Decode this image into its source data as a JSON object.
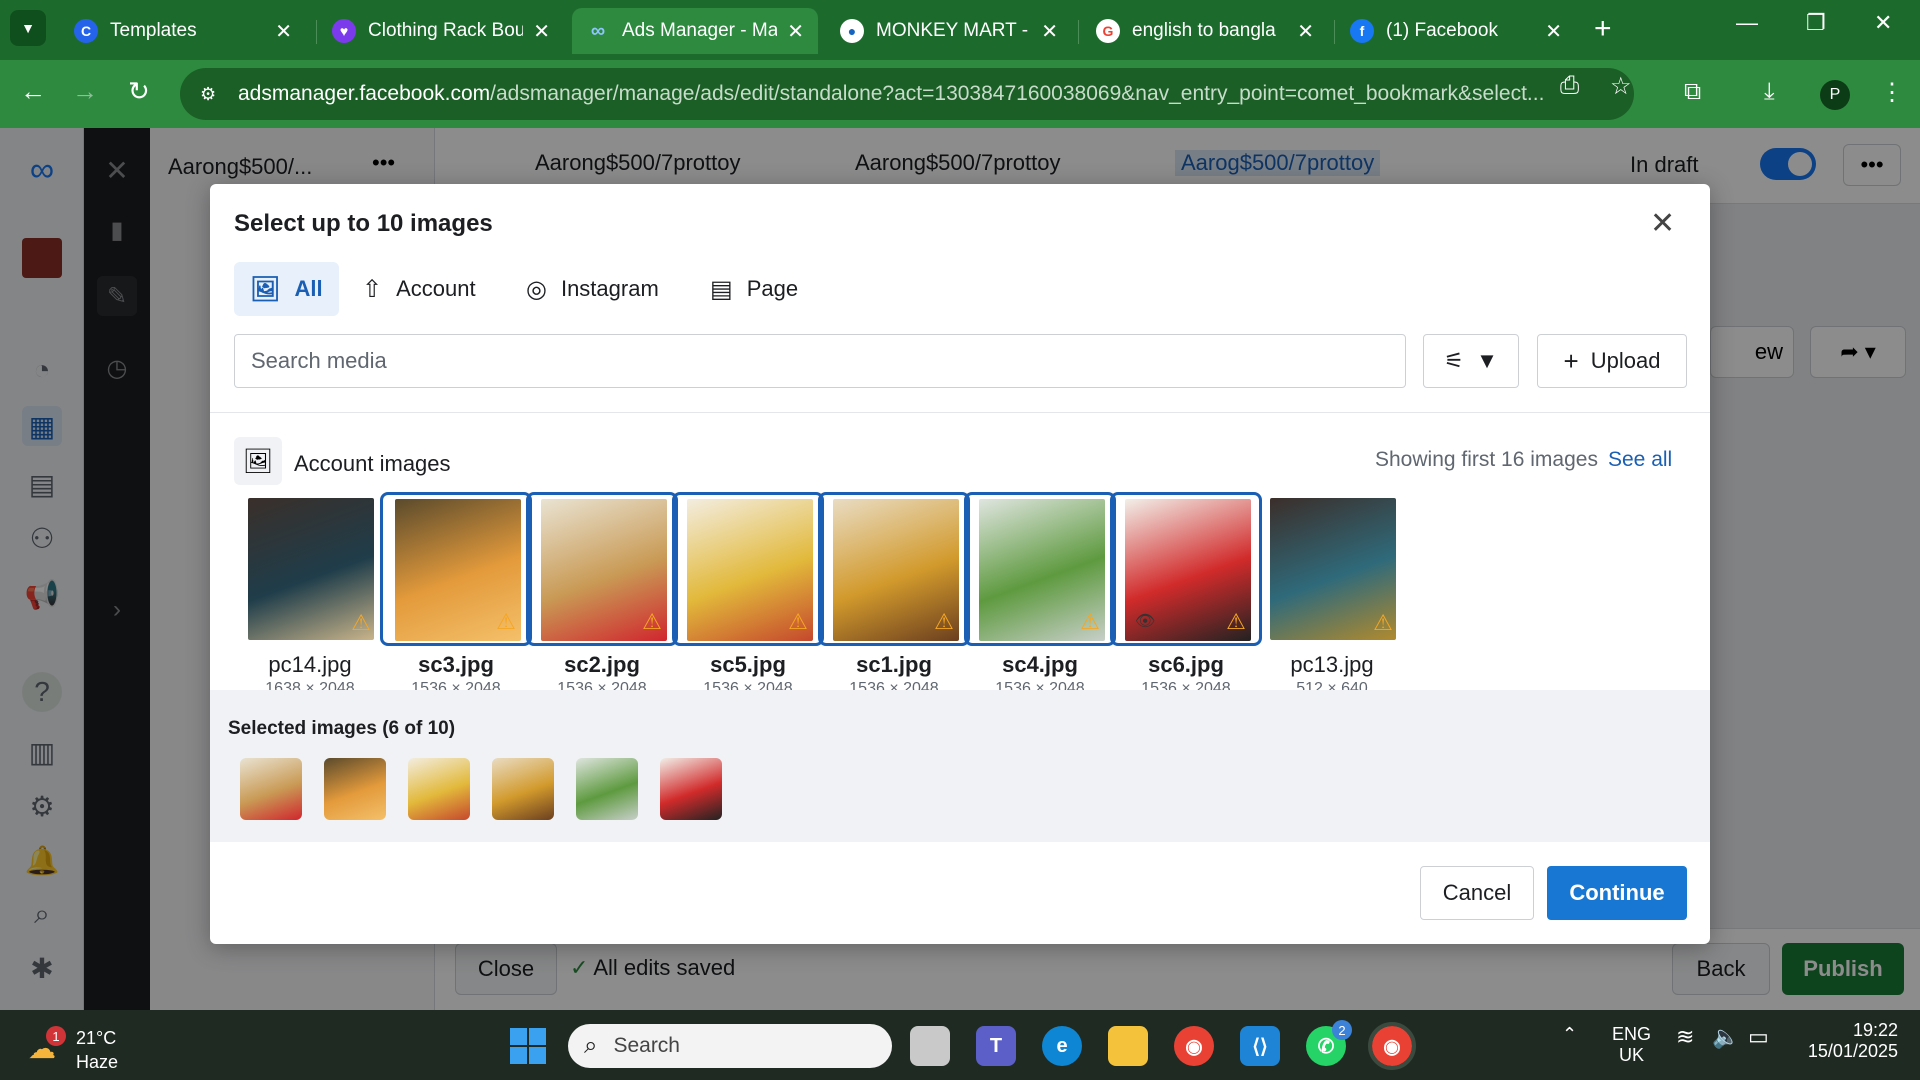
{
  "browser": {
    "tabs": [
      {
        "title": "Templates",
        "icon": "canva-icon",
        "color": "#2563eb"
      },
      {
        "title": "Clothing Rack Bou",
        "icon": "heart-icon",
        "color": "#7c3aed"
      },
      {
        "title": "Ads Manager - Ma",
        "icon": "meta-icon",
        "color": "#1877f2"
      },
      {
        "title": "MONKEY MART - F",
        "icon": "monkey-icon",
        "color": "#1565c0"
      },
      {
        "title": "english to bangla",
        "icon": "google-icon",
        "color": "#ea4335"
      },
      {
        "title": "(1) Facebook",
        "icon": "facebook-icon",
        "color": "#1877f2"
      }
    ],
    "url_host": "adsmanager.facebook.com",
    "url_path": "/adsmanager/manage/ads/edit/standalone?act=1303847160038069&nav_entry_point=comet_bookmark&select...",
    "profile_initial": "P"
  },
  "page": {
    "panel_title": "Aarong$500/...",
    "breadcrumb": [
      "Aarong$500/7prottoy",
      "Aarong$500/7prottoy",
      "Aarog$500/7prottoy"
    ],
    "status": "In draft",
    "bottom": {
      "close": "Close",
      "saved": "All edits saved",
      "back": "Back",
      "publish": "Publish"
    },
    "behind_btn": "ew"
  },
  "modal": {
    "title": "Select up to 10 images",
    "tabs": [
      {
        "label": "All",
        "icon": "images-icon",
        "active": true
      },
      {
        "label": "Account",
        "icon": "upload-arrow-icon",
        "active": false
      },
      {
        "label": "Instagram",
        "icon": "instagram-icon",
        "active": false
      },
      {
        "label": "Page",
        "icon": "page-icon",
        "active": false
      }
    ],
    "search_placeholder": "Search media",
    "upload_label": "Upload",
    "section_title": "Account images",
    "showing": "Showing first 16 images",
    "see_all": "See all",
    "images": [
      {
        "name": "pc14.jpg",
        "dims": "1638 × 2048",
        "selected": false,
        "colors": [
          "#3a2f2a",
          "#1f3d4a",
          "#c9b48a"
        ]
      },
      {
        "name": "sc3.jpg",
        "dims": "1536 × 2048",
        "selected": true,
        "colors": [
          "#5a4a2c",
          "#e39a3b",
          "#f4c06a"
        ]
      },
      {
        "name": "sc2.jpg",
        "dims": "1536 × 2048",
        "selected": true,
        "colors": [
          "#e9e3d2",
          "#c99a55",
          "#d0262e"
        ]
      },
      {
        "name": "sc5.jpg",
        "dims": "1536 × 2048",
        "selected": true,
        "colors": [
          "#f3ede0",
          "#e2b93b",
          "#c5482d"
        ]
      },
      {
        "name": "sc1.jpg",
        "dims": "1536 × 2048",
        "selected": true,
        "colors": [
          "#e9dcc3",
          "#d29a2c",
          "#6b3f1f"
        ]
      },
      {
        "name": "sc4.jpg",
        "dims": "1536 × 2048",
        "selected": true,
        "colors": [
          "#dfe5df",
          "#5e9a3f",
          "#c8cfc9"
        ]
      },
      {
        "name": "sc6.jpg",
        "dims": "1536 × 2048",
        "selected": true,
        "colors": [
          "#f2efe9",
          "#d12b2b",
          "#222222"
        ]
      },
      {
        "name": "pc13.jpg",
        "dims": "512 × 640",
        "selected": false,
        "colors": [
          "#3b2e2a",
          "#2f6a7a",
          "#b08a2e"
        ]
      }
    ],
    "selected_label": "Selected images (6 of 10)",
    "selected_thumbs": [
      {
        "colors": [
          "#e9e3d2",
          "#c99a55",
          "#d0262e"
        ]
      },
      {
        "colors": [
          "#5a4a2c",
          "#e39a3b",
          "#f4c06a"
        ]
      },
      {
        "colors": [
          "#f3ede0",
          "#e2b93b",
          "#c5482d"
        ]
      },
      {
        "colors": [
          "#e9dcc3",
          "#d29a2c",
          "#6b3f1f"
        ]
      },
      {
        "colors": [
          "#dfe5df",
          "#5e9a3f",
          "#c8cfc9"
        ]
      },
      {
        "colors": [
          "#f2efe9",
          "#d12b2b",
          "#222222"
        ]
      }
    ],
    "cancel": "Cancel",
    "continue": "Continue"
  },
  "taskbar": {
    "weather_temp": "21°C",
    "weather_cond": "Haze",
    "weather_badge": "1",
    "search_label": "Search",
    "whatsapp_badge": "2",
    "lang": "ENG",
    "region": "UK",
    "time": "19:22",
    "date": "15/01/2025"
  },
  "colors": {
    "accent": "#1877d2",
    "chrome_green": "#2d8a3f",
    "selected_border": "#1a5fb4"
  }
}
